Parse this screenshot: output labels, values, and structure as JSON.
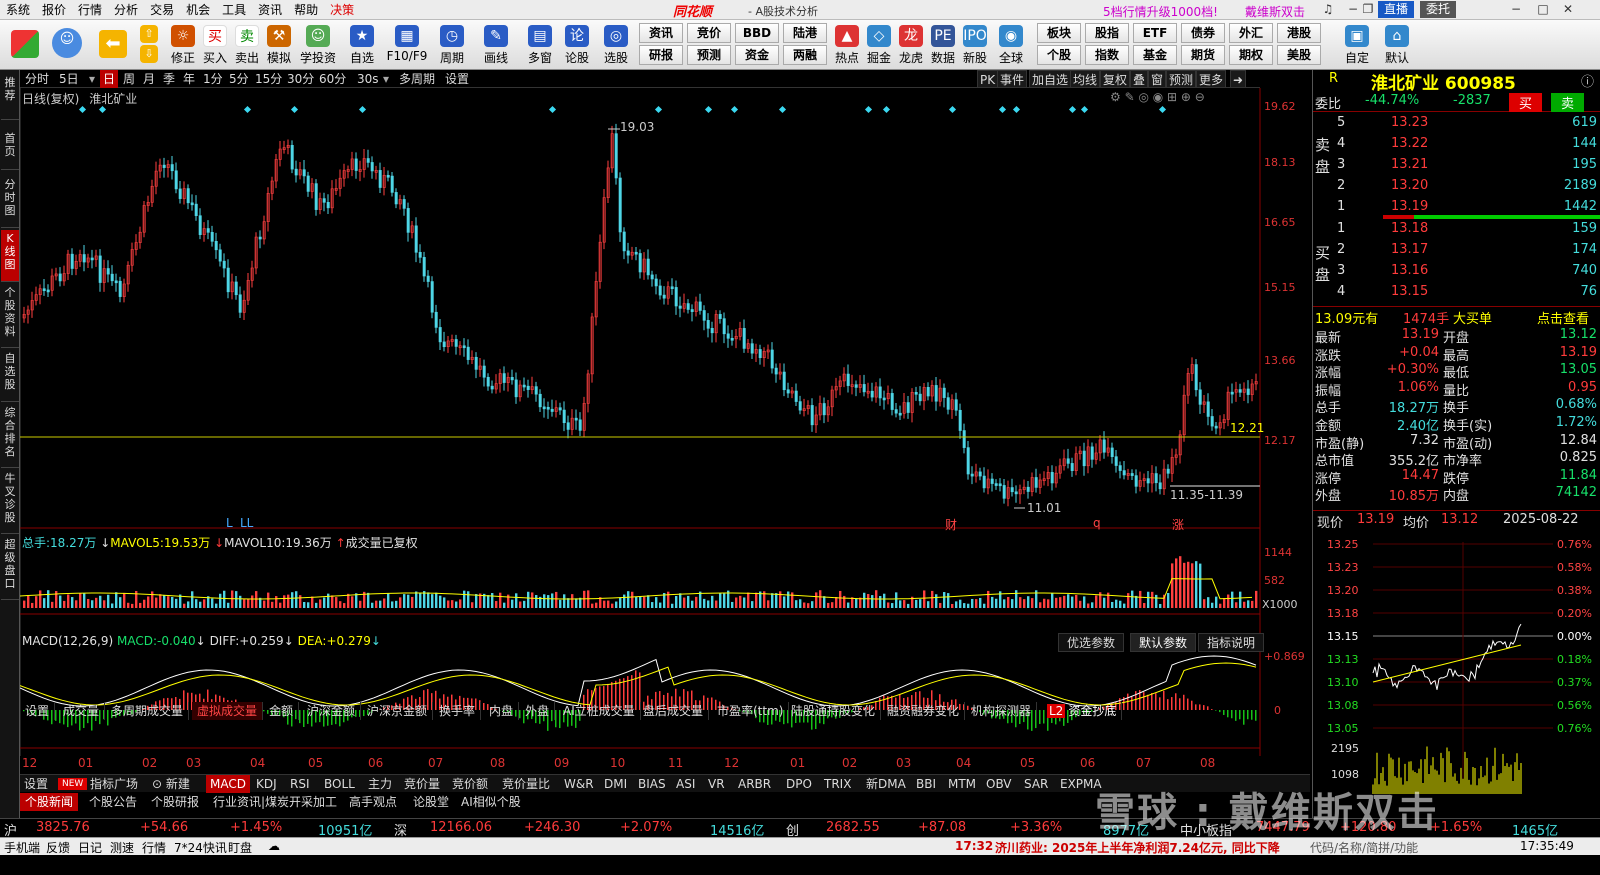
{
  "menubar": {
    "items": [
      "系统",
      "报价",
      "行情",
      "分析",
      "交易",
      "机会",
      "工具",
      "资讯",
      "帮助",
      "决策"
    ],
    "brand": "同花顺",
    "brand_sub": "- A股技术分析",
    "promo": "5档行情升级1000档!",
    "promo2": "戴维斯双击",
    "live_btn": "直播",
    "entrust_btn": "委托"
  },
  "toolbar": {
    "buttons": [
      "",
      "",
      "修正",
      "买入",
      "卖出",
      "模拟",
      "学投资",
      "自选",
      "F10/F9",
      "周期",
      "画线",
      "多窗",
      "论股",
      "选股"
    ],
    "grid_top": [
      "资讯",
      "竞价",
      "BBD",
      "陆港",
      "热点",
      "掘金",
      "龙虎",
      "数据",
      "新股",
      "全球",
      "板块",
      "股指",
      "ETF",
      "债券",
      "外汇",
      "港股",
      "自定",
      "默认"
    ],
    "grid_bottom": [
      "研报",
      "预测",
      "资金",
      "两融",
      "",
      "",
      "",
      "",
      "",
      "",
      "个股",
      "指数",
      "基金",
      "期货",
      "期权",
      "美股"
    ]
  },
  "left_sidebar": [
    "推荐",
    "首页",
    "分时图",
    "K线图",
    "个股资料",
    "自选股",
    "综合排名",
    "牛叉诊股",
    "超级盘口"
  ],
  "periodbar": {
    "items": [
      "分时",
      "5日",
      "日",
      "周",
      "月",
      "季",
      "年",
      "1分",
      "5分",
      "15分",
      "30分",
      "60分",
      "30s",
      "多周期",
      "设置"
    ],
    "active": "日",
    "right_items": [
      "PK",
      "事件",
      "加自选",
      "均线",
      "复权",
      "叠",
      "窗",
      "预测",
      "更多"
    ]
  },
  "chart": {
    "title": "日线(复权)",
    "stock_name": "淮北矿业",
    "y_labels": [
      "19.62",
      "18.13",
      "16.65",
      "15.15",
      "13.66",
      "12.17"
    ],
    "high_label": "19.03",
    "low_label": "11.01",
    "line_label": "12.21",
    "range_label": "11.35-11.39",
    "markers": [
      "L",
      "LL",
      "财",
      "q",
      "涨"
    ],
    "volume": {
      "title": "总手:",
      "value": "18.27万",
      "ma5_label": "MAVOL5:",
      "ma5": "19.53万",
      "ma10_label": "MAVOL10:",
      "ma10": "19.36万",
      "note": "成交量已复权",
      "y1": "1144",
      "y2": "582",
      "unit": "X1000"
    },
    "tabs": [
      "设置",
      "成交量",
      "多周期成交量",
      "虚拟成交量",
      "金额",
      "沪深金额",
      "沪深京金额",
      "换手率",
      "内盘",
      "外盘",
      "AI立桩成交量",
      "盘后成交量",
      "市盈率(ttm)",
      "陆股通持股变化",
      "融资融券变化",
      "机构探测器",
      "资金抄底"
    ],
    "active_tab": "虚拟成交量",
    "macd": {
      "title": "MACD(12,26,9)",
      "macd_label": "MACD:",
      "macd": "-0.040",
      "diff_label": "DIFF:",
      "diff": "+0.259",
      "dea_label": "DEA:",
      "dea": "+0.279",
      "y_top": "+0.869",
      "y_zero": "0",
      "btns": [
        "优选参数",
        "默认参数",
        "指标说明"
      ]
    },
    "x_labels": [
      "12",
      "01",
      "02",
      "03",
      "04",
      "05",
      "06",
      "07",
      "08",
      "09",
      "10",
      "11",
      "12",
      "01",
      "02",
      "03",
      "04",
      "05",
      "06",
      "07",
      "08"
    ],
    "ind_tabs": [
      "设置",
      "NEW",
      "指标广场",
      "新建",
      "MACD",
      "KDJ",
      "RSI",
      "BOLL",
      "主力",
      "竞价量",
      "竞价额",
      "竞价量比",
      "W&R",
      "DMI",
      "BIAS",
      "ASI",
      "VR",
      "ARBR",
      "DPO",
      "TRIX",
      "新DMA",
      "BBI",
      "MTM",
      "OBV",
      "SAR",
      "EXPMA"
    ],
    "news_tabs": [
      "个股新闻",
      "个股公告",
      "个股研报",
      "行业资讯|煤炭开采加工",
      "高手观点",
      "论股堂",
      "AI相似个股"
    ]
  },
  "right_panel": {
    "tag": "R",
    "title": "淮北矿业 600985",
    "weibi_label": "委比",
    "weibi": "-44.74%",
    "weicha": "-2837",
    "buy_btn": "买",
    "sell_btn": "卖",
    "sell_label": "卖盘",
    "buy_label": "买盘",
    "asks": [
      [
        "5",
        "13.23",
        "619"
      ],
      [
        "4",
        "13.22",
        "144"
      ],
      [
        "3",
        "13.21",
        "195"
      ],
      [
        "2",
        "13.20",
        "2189"
      ],
      [
        "1",
        "13.19",
        "1442"
      ]
    ],
    "bids": [
      [
        "1",
        "13.18",
        "159"
      ],
      [
        "2",
        "13.17",
        "174"
      ],
      [
        "3",
        "13.16",
        "740"
      ],
      [
        "4",
        "13.15",
        "76"
      ]
    ],
    "bigorder": {
      "price": "13.09元有",
      "qty": "1474手",
      "type": "大买单",
      "link": "点击查看"
    },
    "stats": [
      [
        "最新",
        "13.19",
        "开盘",
        "13.12"
      ],
      [
        "涨跌",
        "+0.04",
        "最高",
        "13.19"
      ],
      [
        "涨幅",
        "+0.30%",
        "最低",
        "13.05"
      ],
      [
        "振幅",
        "1.06%",
        "量比",
        "0.95"
      ],
      [
        "总手",
        "18.27万",
        "换手",
        "0.68%"
      ],
      [
        "金额",
        "2.40亿",
        "换手(实)",
        "1.72%"
      ],
      [
        "市盈(静)",
        "7.32",
        "市盈(动)",
        "12.84"
      ],
      [
        "总市值",
        "355.2亿",
        "市净率",
        "0.825"
      ],
      [
        "涨停",
        "14.47",
        "跌停",
        "11.84"
      ],
      [
        "外盘",
        "10.85万",
        "内盘",
        "74142"
      ]
    ],
    "mini": {
      "xj_label": "现价",
      "xj": "13.19",
      "jj_label": "均价",
      "jj": "13.12",
      "date": "2025-08-22",
      "y_left": [
        "13.25",
        "13.23",
        "13.20",
        "13.18",
        "13.15",
        "13.13",
        "13.10",
        "13.08",
        "13.05"
      ],
      "y_right": [
        "0.76%",
        "0.58%",
        "0.38%",
        "0.20%",
        "0.00%",
        "0.18%",
        "0.37%",
        "0.56%",
        "0.76%"
      ],
      "vol_labels": [
        "2195",
        "1098"
      ]
    }
  },
  "index_bar": {
    "sh_label": "沪",
    "sh": "3825.76",
    "sh_chg": "+54.66",
    "sh_pct": "+1.45%",
    "sh_amt": "10951亿",
    "sz_label": "深",
    "sz": "12166.06",
    "sz_chg": "+246.30",
    "sz_pct": "+2.07%",
    "sz_amt": "14516亿",
    "cy_label": "创",
    "cy": "2682.55",
    "cy_chg": "+87.08",
    "cy_pct": "+3.36%",
    "cy_amt": "8977亿",
    "zx_label": "中小板指",
    "zx": "7447.79",
    "zx_chg": "+120.80",
    "zx_pct": "+1.65%",
    "zx_amt": "1465亿"
  },
  "status": {
    "items": [
      "手机端",
      "反馈",
      "日记",
      "测速",
      "行情",
      "7*24快讯",
      "盯盘"
    ],
    "news_time": "17:32",
    "news": "济川药业: 2025年上半年净利润7.24亿元, 同比下降",
    "search": "代码/名称/简拼/功能",
    "clock": "17:35:49"
  },
  "watermark": "雪球 : 戴维斯双击"
}
